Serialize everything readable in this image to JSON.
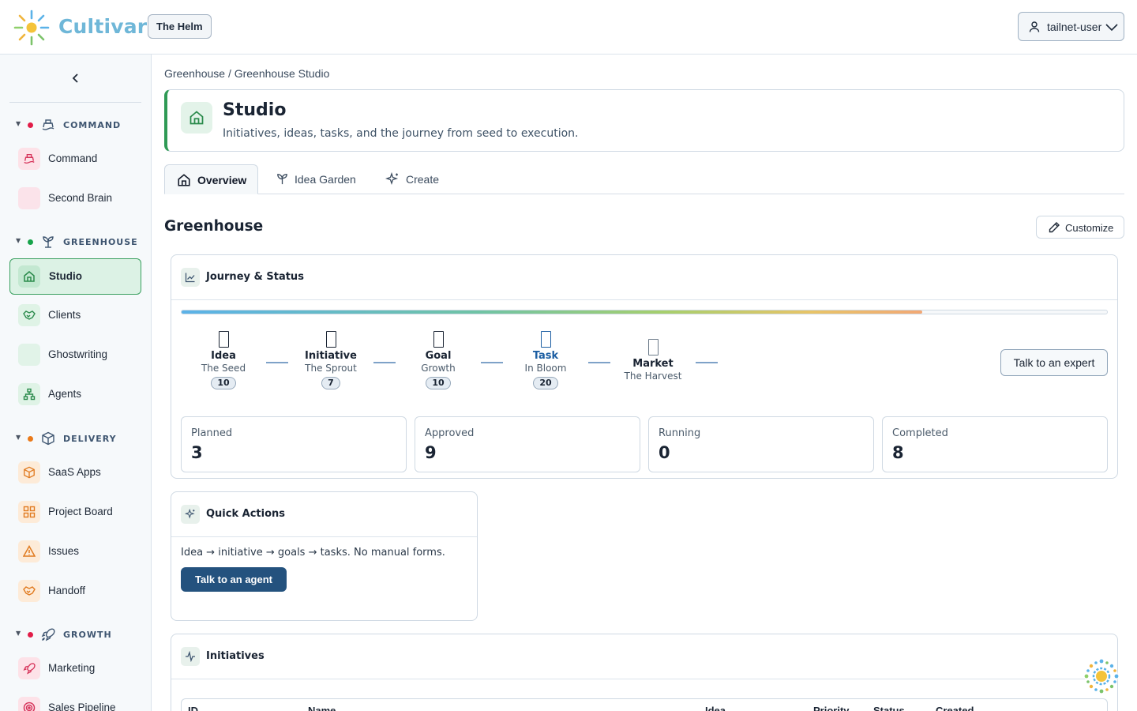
{
  "header": {
    "brand": "Cultivar",
    "workspace_button": "The Helm",
    "user_menu": "tailnet-user",
    "logo_icon": "sun-logo-icon"
  },
  "sidebar": {
    "sections": [
      {
        "title": "COMMAND",
        "dot_color": "#e11d48",
        "icon": "ship-icon",
        "items": [
          {
            "label": "Command",
            "icon": "ship-icon"
          },
          {
            "label": "Second Brain",
            "icon": "blank-icon"
          }
        ]
      },
      {
        "title": "GREENHOUSE",
        "dot_color": "#16a34a",
        "icon": "sprout-icon",
        "items": [
          {
            "label": "Studio",
            "icon": "home-icon",
            "active": true
          },
          {
            "label": "Clients",
            "icon": "handshake-icon"
          },
          {
            "label": "Ghostwriting",
            "icon": "blank-icon"
          },
          {
            "label": "Agents",
            "icon": "network-icon"
          }
        ]
      },
      {
        "title": "DELIVERY",
        "dot_color": "#ea7a1a",
        "icon": "package-icon",
        "items": [
          {
            "label": "SaaS Apps",
            "icon": "package-icon"
          },
          {
            "label": "Project Board",
            "icon": "grid-icon"
          },
          {
            "label": "Issues",
            "icon": "warning-icon"
          },
          {
            "label": "Handoff",
            "icon": "handshake-icon"
          }
        ]
      },
      {
        "title": "GROWTH",
        "dot_color": "#e11d48",
        "icon": "rocket-icon",
        "items": [
          {
            "label": "Marketing",
            "icon": "rocket-icon"
          },
          {
            "label": "Sales Pipeline",
            "icon": "target-icon"
          }
        ]
      }
    ]
  },
  "breadcrumb": "Greenhouse / Greenhouse Studio",
  "page": {
    "title": "Studio",
    "subtitle": "Initiatives, ideas, tasks, and the journey from seed to execution."
  },
  "tabs": [
    {
      "label": "Overview",
      "icon": "home-icon",
      "active": true
    },
    {
      "label": "Idea Garden",
      "icon": "sprout-icon"
    },
    {
      "label": "Create",
      "icon": "sparkle-icon"
    }
  ],
  "section_title": "Greenhouse",
  "customize_button": "Customize",
  "journey": {
    "title": "Journey & Status",
    "progress_fraction": 0.8,
    "stages": [
      {
        "name": "Idea",
        "sub": "The Seed",
        "count": "10"
      },
      {
        "name": "Initiative",
        "sub": "The Sprout",
        "count": "7"
      },
      {
        "name": "Goal",
        "sub": "Growth",
        "count": "10"
      },
      {
        "name": "Task",
        "sub": "In Bloom",
        "count": "20",
        "current": true
      },
      {
        "name": "Market",
        "sub": "The Harvest",
        "count": null
      }
    ],
    "expert_button": "Talk to an expert",
    "stats": [
      {
        "label": "Planned",
        "value": "3"
      },
      {
        "label": "Approved",
        "value": "9"
      },
      {
        "label": "Running",
        "value": "0"
      },
      {
        "label": "Completed",
        "value": "8"
      }
    ]
  },
  "quick_actions": {
    "title": "Quick Actions",
    "text": "Idea → initiative → goals → tasks. No manual forms.",
    "button": "Talk to an agent"
  },
  "initiatives": {
    "title": "Initiatives",
    "columns": [
      "ID",
      "Name",
      "Idea",
      "Priority",
      "Status",
      "Created"
    ]
  },
  "colors": {
    "accent_green": "#2f9a55",
    "primary_button": "#24527e",
    "current_stage": "#1d5fa3",
    "brand_text": "#6fb7d8"
  }
}
